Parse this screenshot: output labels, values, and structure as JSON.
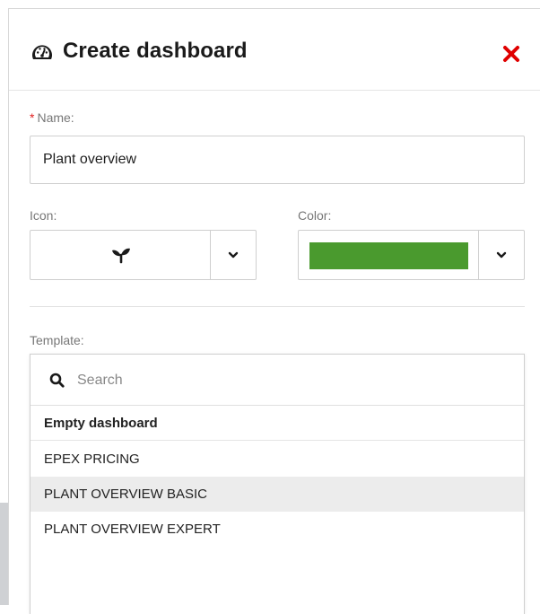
{
  "dialog": {
    "title": "Create dashboard",
    "title_icon": "dashboard-gauge-icon",
    "close_icon": "close-x-icon"
  },
  "form": {
    "name": {
      "required_marker": "*",
      "label": "Name:",
      "value": "Plant overview"
    },
    "icon": {
      "label": "Icon:",
      "selected_icon": "seedling-icon"
    },
    "color": {
      "label": "Color:",
      "selected_color": "#4a9a2e"
    },
    "template": {
      "label": "Template:",
      "search_placeholder": "Search",
      "options": [
        {
          "label": "Empty dashboard",
          "group": true
        },
        {
          "label": "EPEX PRICING"
        },
        {
          "label": "PLANT OVERVIEW BASIC",
          "highlighted": true
        },
        {
          "label": "PLANT OVERVIEW EXPERT"
        }
      ]
    }
  },
  "colors": {
    "close": "#e00000",
    "swatch": "#4a9a2e",
    "hover_row": "#ececec"
  }
}
